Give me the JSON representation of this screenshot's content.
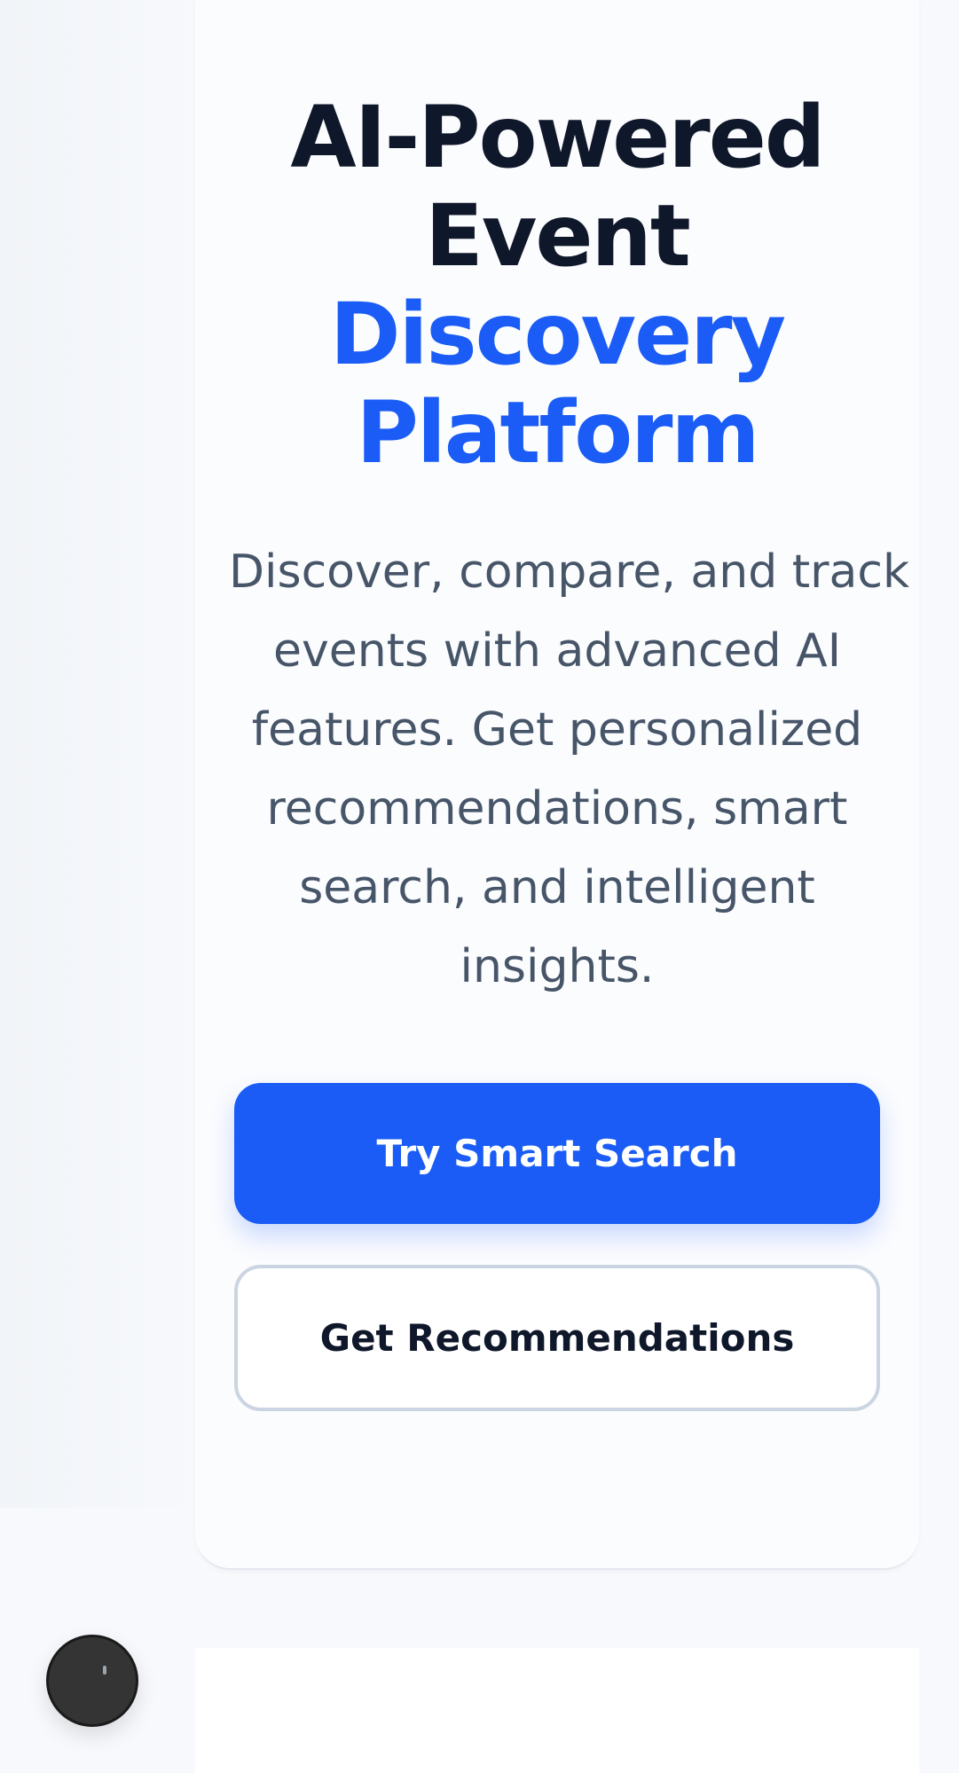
{
  "hero": {
    "title_lines": [
      "AI-Powered",
      "Event"
    ],
    "title_accent_lines": [
      "Discovery",
      "Platform"
    ],
    "subtitle_lines": [
      "Discover, compare, and track",
      "events with advanced AI",
      "features. Get personalized",
      "recommendations, smart",
      "search, and intelligent",
      "insights."
    ]
  },
  "actions": {
    "primary_label": "Try Smart Search",
    "secondary_label": "Get Recommendations"
  },
  "colors": {
    "accent": "#1a5cf5",
    "heading": "#0f172a",
    "body_text": "#475569",
    "fab": "#343434"
  },
  "icons": {
    "fab": "floating-action-icon"
  }
}
